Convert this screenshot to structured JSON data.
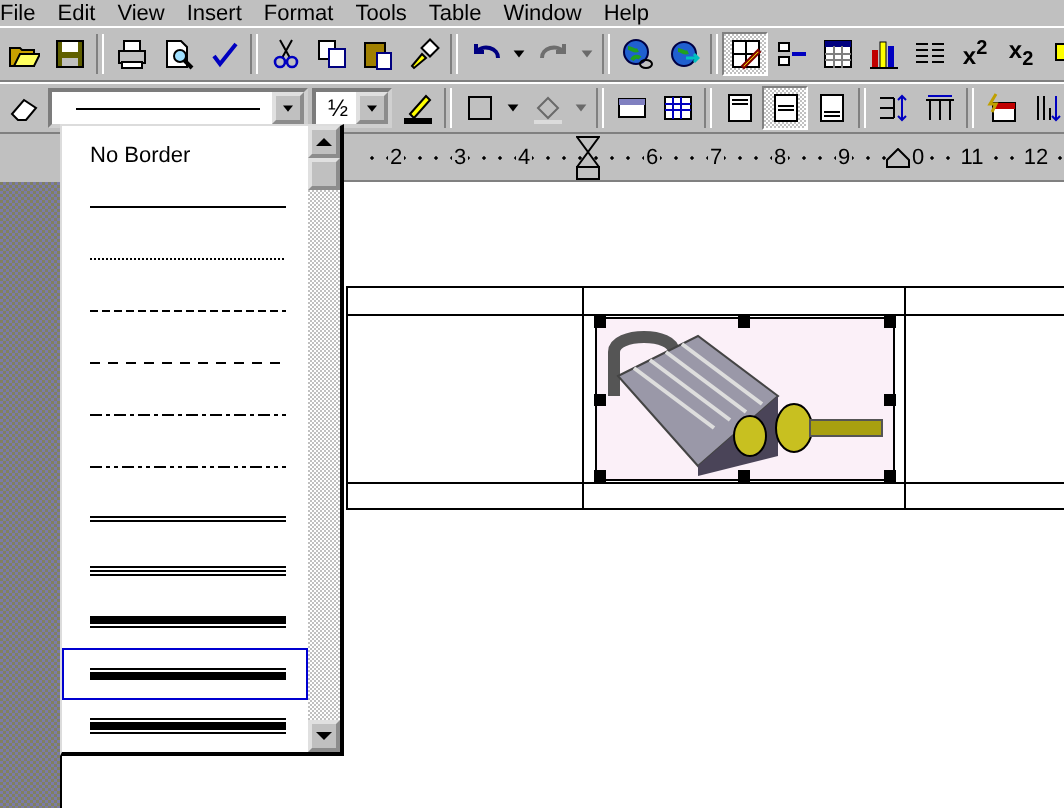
{
  "menu": [
    {
      "label": "File"
    },
    {
      "label": "Edit"
    },
    {
      "label": "View"
    },
    {
      "label": "Insert"
    },
    {
      "label": "Format"
    },
    {
      "label": "Tools"
    },
    {
      "label": "Table"
    },
    {
      "label": "Window"
    },
    {
      "label": "Help"
    }
  ],
  "toolbar_1": [
    {
      "kind": "open",
      "pressed": false,
      "disabled": false
    },
    {
      "kind": "save",
      "pressed": false,
      "disabled": false
    },
    {
      "kind": "sep"
    },
    {
      "kind": "print",
      "pressed": false,
      "disabled": false
    },
    {
      "kind": "preview",
      "pressed": false,
      "disabled": false
    },
    {
      "kind": "spelling",
      "pressed": false,
      "disabled": false
    },
    {
      "kind": "sep"
    },
    {
      "kind": "cut",
      "pressed": false,
      "disabled": false
    },
    {
      "kind": "copy",
      "pressed": false,
      "disabled": false
    },
    {
      "kind": "paste",
      "pressed": false,
      "disabled": false
    },
    {
      "kind": "painter",
      "pressed": false,
      "disabled": false
    },
    {
      "kind": "sep"
    },
    {
      "kind": "undo",
      "pressed": false,
      "disabled": false
    },
    {
      "kind": "arrow",
      "pressed": false,
      "disabled": false
    },
    {
      "kind": "redo",
      "pressed": false,
      "disabled": true
    },
    {
      "kind": "arrow",
      "pressed": false,
      "disabled": true
    },
    {
      "kind": "sep"
    },
    {
      "kind": "hyperlink",
      "pressed": false,
      "disabled": false
    },
    {
      "kind": "web",
      "pressed": false,
      "disabled": false
    },
    {
      "kind": "sep"
    },
    {
      "kind": "tables",
      "pressed": true,
      "disabled": false
    },
    {
      "kind": "table",
      "pressed": false,
      "disabled": false
    },
    {
      "kind": "sheet",
      "pressed": false,
      "disabled": false
    },
    {
      "kind": "chart",
      "pressed": false,
      "disabled": false
    },
    {
      "kind": "columns",
      "pressed": false,
      "disabled": false
    },
    {
      "kind": "superscript",
      "label": "x$^{2}$",
      "pressed": false,
      "disabled": false
    },
    {
      "kind": "subscript",
      "label": "x$_{2}$",
      "pressed": false,
      "disabled": false
    },
    {
      "kind": "drawing",
      "pressed": false,
      "disabled": false
    }
  ],
  "toolbar_2": [
    {
      "kind": "eraser",
      "pressed": false,
      "disabled": false
    },
    {
      "kind": "style"
    },
    {
      "kind": "weight",
      "value": "½"
    },
    {
      "kind": "pen",
      "pressed": false,
      "disabled": false
    },
    {
      "kind": "sep"
    },
    {
      "kind": "borders",
      "pressed": false,
      "disabled": false
    },
    {
      "kind": "arrow",
      "pressed": false,
      "disabled": false
    },
    {
      "kind": "shading",
      "pressed": false,
      "disabled": true
    },
    {
      "kind": "arrow",
      "pressed": false,
      "disabled": true
    },
    {
      "kind": "sep"
    },
    {
      "kind": "merge",
      "pressed": false,
      "disabled": false
    },
    {
      "kind": "split",
      "pressed": false,
      "disabled": false
    },
    {
      "kind": "sep"
    },
    {
      "kind": "top",
      "pressed": false,
      "disabled": false
    },
    {
      "kind": "center",
      "pressed": true,
      "disabled": false
    },
    {
      "kind": "bottom",
      "pressed": false,
      "disabled": false
    },
    {
      "kind": "sep"
    },
    {
      "kind": "rows",
      "pressed": false,
      "disabled": false
    },
    {
      "kind": "cols",
      "pressed": false,
      "disabled": false
    },
    {
      "kind": "sep"
    },
    {
      "kind": "autoformat",
      "pressed": false,
      "disabled": false
    },
    {
      "kind": "sort",
      "pressed": false,
      "disabled": false
    }
  ],
  "border_style_list": [
    {
      "kind": "none",
      "label": "No Border",
      "selected": false
    },
    {
      "kind": "solid",
      "selected": false
    },
    {
      "kind": "dotted",
      "selected": false
    },
    {
      "kind": "dashed",
      "selected": false
    },
    {
      "kind": "wide-dashed",
      "selected": false
    },
    {
      "kind": "dash-dot",
      "selected": false
    },
    {
      "kind": "dash-dot-dot",
      "selected": false
    },
    {
      "kind": "double",
      "selected": false
    },
    {
      "kind": "triple",
      "selected": false
    },
    {
      "kind": "thick-thin",
      "selected": false
    },
    {
      "kind": "thin-thick",
      "selected": true
    },
    {
      "kind": "thin-thick-thin",
      "selected": false
    }
  ],
  "ruler": [
    {
      "kind": "number",
      "label": "2"
    },
    {
      "kind": "number",
      "label": "3"
    },
    {
      "kind": "number",
      "label": "4"
    },
    {
      "kind": "indent"
    },
    {
      "kind": "number",
      "label": "6"
    },
    {
      "kind": "number",
      "label": "7"
    },
    {
      "kind": "number",
      "label": "8"
    },
    {
      "kind": "number",
      "label": "9"
    },
    {
      "kind": "right-indent",
      "label": "0"
    },
    {
      "kind": "number",
      "label": "11"
    },
    {
      "kind": "number",
      "label": "12"
    }
  ],
  "picture": {
    "selected": true
  }
}
